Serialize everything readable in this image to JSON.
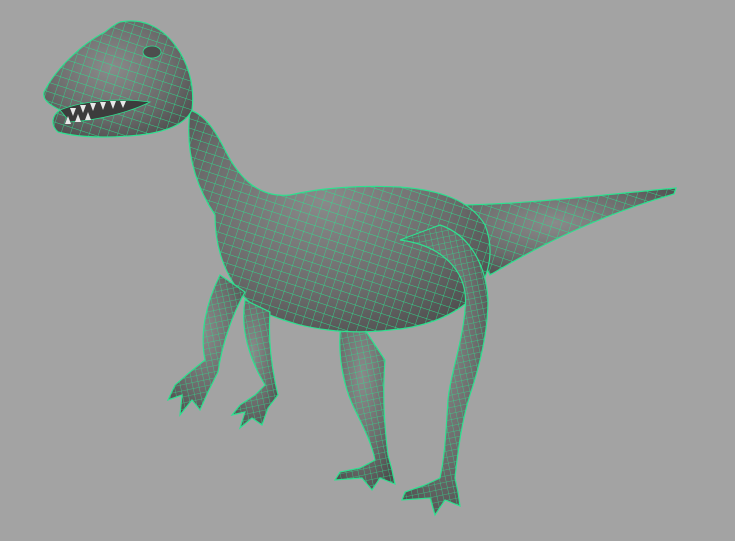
{
  "viewport": {
    "background_color": "#a3a3a3",
    "model_fill_color": "#6b6b6b",
    "model_shadow_color": "#4d4d4d",
    "model_highlight_color": "#8a8a8a",
    "wireframe_color": "#2ee08f",
    "teeth_color": "#e8e8e8",
    "mouth_color": "#3c3c3c"
  },
  "model": {
    "icon": "dinosaur-wireframe-model"
  }
}
